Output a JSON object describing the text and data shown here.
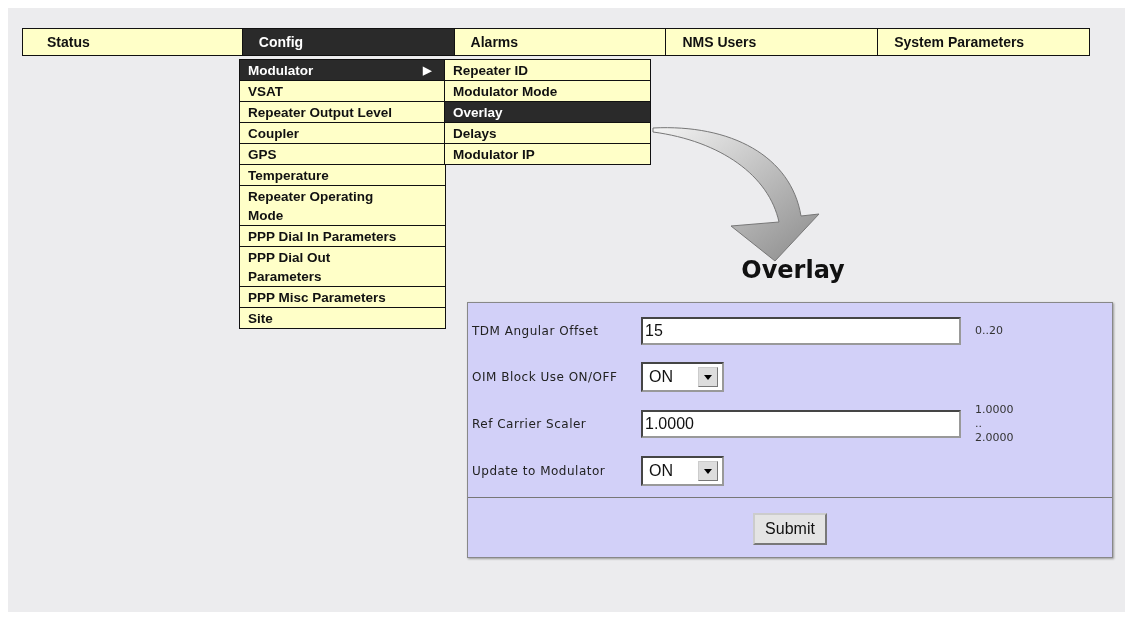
{
  "menu_bar": [
    {
      "label": "Status",
      "selected": false
    },
    {
      "label": "Config",
      "selected": true
    },
    {
      "label": "Alarms",
      "selected": false
    },
    {
      "label": "NMS Users",
      "selected": false
    },
    {
      "label": "System Parameters",
      "selected": false
    }
  ],
  "config_menu": [
    {
      "label": "Modulator",
      "selected": true,
      "submenu": true
    },
    {
      "label": "VSAT",
      "selected": false
    },
    {
      "label": "Repeater Output Level",
      "selected": false
    },
    {
      "label": "Coupler",
      "selected": false
    },
    {
      "label": "GPS",
      "selected": false
    },
    {
      "label": "Temperature",
      "selected": false
    },
    {
      "label": "Repeater Operating Mode",
      "selected": false
    },
    {
      "label": "PPP Dial In Parameters",
      "selected": false
    },
    {
      "label": "PPP Dial Out Parameters",
      "selected": false
    },
    {
      "label": "PPP Misc Parameters",
      "selected": false
    },
    {
      "label": "Site",
      "selected": false
    }
  ],
  "submenu_arrow": "▶",
  "modulator_menu": [
    {
      "label": "Repeater ID",
      "selected": false
    },
    {
      "label": "Modulator Mode",
      "selected": false
    },
    {
      "label": "Overlay",
      "selected": true
    },
    {
      "label": "Delays",
      "selected": false
    },
    {
      "label": "Modulator IP",
      "selected": false
    }
  ],
  "page_title": "Overlay",
  "form": {
    "fields": [
      {
        "kind": "text",
        "label": "TDM Angular Offset",
        "value": "15",
        "range": [
          "0..20"
        ]
      },
      {
        "kind": "select",
        "label": "OIM Block Use ON/OFF",
        "value": "ON"
      },
      {
        "kind": "text",
        "label": "Ref Carrier Scaler",
        "value": "1.0000",
        "range": [
          "1.0000",
          "..",
          "2.0000"
        ]
      },
      {
        "kind": "select",
        "label": "Update to Modulator",
        "value": "ON"
      }
    ],
    "submit": "Submit"
  }
}
